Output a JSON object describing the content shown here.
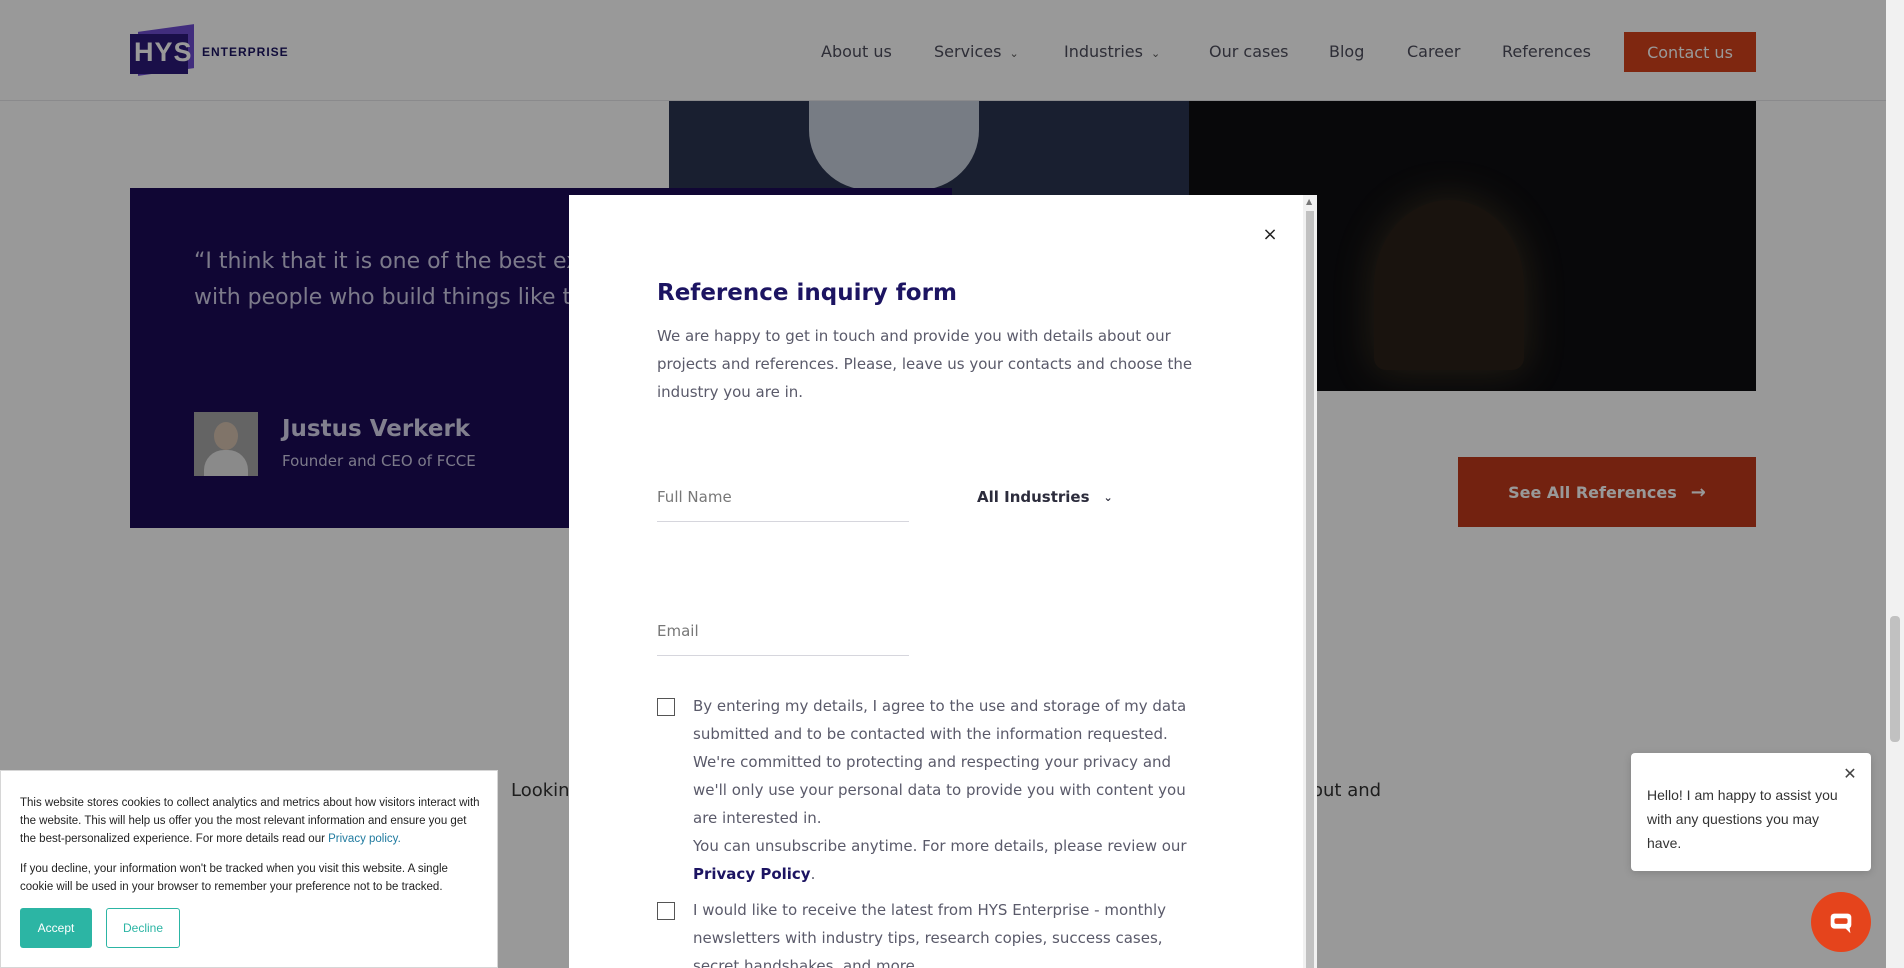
{
  "header": {
    "logo_text": "HYS",
    "logo_sub": "ENTERPRISE",
    "nav": [
      {
        "label": "About us",
        "has_dropdown": false
      },
      {
        "label": "Services",
        "has_dropdown": true
      },
      {
        "label": "Industries",
        "has_dropdown": true
      },
      {
        "label": "Our cases",
        "has_dropdown": false
      },
      {
        "label": "Blog",
        "has_dropdown": false
      },
      {
        "label": "Career",
        "has_dropdown": false
      },
      {
        "label": "References",
        "has_dropdown": false
      }
    ],
    "contact_label": "Contact us"
  },
  "testimonial": {
    "quote_line1": "“I think that it is one of the best ex",
    "quote_line2": "with people who build things like t",
    "name": "Justus Verkerk",
    "role": "Founder and CEO of FCCE"
  },
  "references_button": {
    "label": "See All References",
    "icon": "arrow-right-icon"
  },
  "background_text": {
    "left_fragment": "Looking",
    "right_fragment": "out and"
  },
  "modal": {
    "close_glyph": "×",
    "title": "Reference inquiry form",
    "description": "We are happy to get in touch and provide you with details about our projects and references. Please, leave us your contacts and choose the industry you are in.",
    "full_name_placeholder": "Full Name",
    "email_placeholder": "Email",
    "industry_value": "All Industries",
    "consent_text": "By entering my details, I agree to the use and storage of my data submitted and to be contacted with the information requested. We're committed to protecting and respecting your privacy and we'll only use your personal data to provide you with content you are interested in.",
    "unsubscribe_text": "You can unsubscribe anytime. For more details, please review our",
    "privacy_link": "Privacy Policy",
    "newsletter_text": "I would like to receive the latest from HYS Enterprise - monthly newsletters with industry tips, research copies, success cases, secret handshakes, and more."
  },
  "cookie_banner": {
    "text1": "This website stores cookies to collect analytics and metrics about how visitors interact with the website. This will help us offer you the most relevant information and ensure you get the best-personalized experience. For more details read our",
    "privacy_link": "Privacy policy.",
    "text2": "If you decline, your information won't be tracked when you visit this website. A single cookie will be used in your browser to remember your preference not to be tracked.",
    "accept_label": "Accept",
    "decline_label": "Decline"
  },
  "chat": {
    "message": "Hello! I am happy to assist you with any questions you may have.",
    "close_glyph": "✕"
  },
  "colors": {
    "brand_navy": "#1b0b57",
    "accent_orange": "#d4421c",
    "cookie_teal": "#2cb5a4"
  }
}
